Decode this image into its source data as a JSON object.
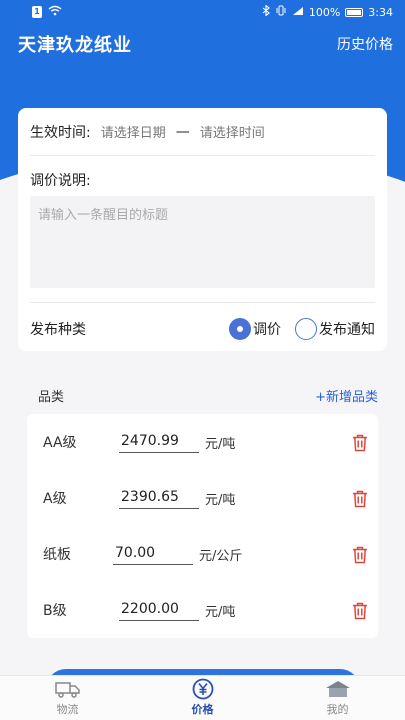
{
  "status_bar": {
    "sim": "1",
    "battery_pct": "100%",
    "time": "3:34"
  },
  "app_bar": {
    "title": "天津玖龙纸业",
    "history": "历史价格"
  },
  "form": {
    "effective_label": "生效时间:",
    "date_placeholder": "请选择日期",
    "dash": "—",
    "time_placeholder": "请选择时间",
    "note_label": "调价说明:",
    "note_placeholder": "请输入一条醒目的标题",
    "kind_label": "发布种类",
    "kinds": [
      {
        "label": "调价",
        "checked": true
      },
      {
        "label": "发布通知",
        "checked": false
      }
    ]
  },
  "categories": {
    "title": "品类",
    "add_label": "+新增品类",
    "items": [
      {
        "name": "AA级",
        "price": "2470.99",
        "unit": "元/吨"
      },
      {
        "name": "A级",
        "price": "2390.65",
        "unit": "元/吨"
      },
      {
        "name": "纸板",
        "price": "70.00",
        "unit": "元/公斤"
      },
      {
        "name": "B级",
        "price": "2200.00",
        "unit": "元/吨"
      }
    ]
  },
  "tabs": [
    {
      "label": "物流",
      "icon": "truck-icon",
      "active": false
    },
    {
      "label": "价格",
      "icon": "yen-icon",
      "active": true
    },
    {
      "label": "我的",
      "icon": "home-icon",
      "active": false
    }
  ],
  "colors": {
    "primary": "#1f6fde",
    "accent": "#2a61d8",
    "delete": "#e0463c"
  }
}
